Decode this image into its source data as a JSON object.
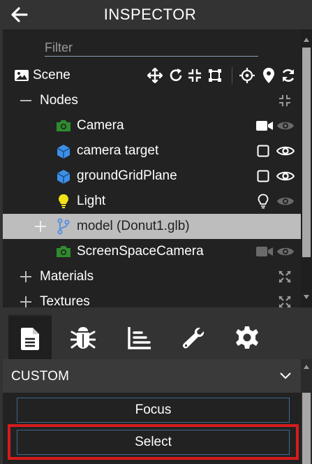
{
  "header": {
    "title": "INSPECTOR",
    "back_icon": "arrow-left-icon"
  },
  "filter": {
    "placeholder": "Filter",
    "value": ""
  },
  "scene": {
    "label": "Scene",
    "tools": [
      "move-icon",
      "rotate-icon",
      "scale-icon",
      "bounding-box-icon",
      "crosshair-icon",
      "marker-icon",
      "refresh-icon"
    ]
  },
  "nodes": {
    "label": "Nodes",
    "items": [
      {
        "label": "Camera",
        "icon": "camera-icon",
        "color": "#2e8b2e",
        "action": "video-icon",
        "visibility": "eye-icon"
      },
      {
        "label": "camera target",
        "icon": "cube-icon",
        "color": "#3d8fe6",
        "action": "checkbox-icon",
        "visibility": "eye-icon"
      },
      {
        "label": "groundGridPlane",
        "icon": "cube-icon",
        "color": "#3d8fe6",
        "action": "checkbox-icon",
        "visibility": "eye-icon"
      },
      {
        "label": "Light",
        "icon": "lightbulb-icon",
        "color": "#f2e21a",
        "action": "lightbulb-outline-icon",
        "visibility": "eye-icon"
      },
      {
        "label": "model (Donut1.glb)",
        "icon": "branch-icon",
        "color": "#5b8fe0",
        "selected": true
      },
      {
        "label": "ScreenSpaceCamera",
        "icon": "camera-icon",
        "color": "#2e8b2e",
        "action": "video-icon",
        "visibility": "eye-icon"
      }
    ]
  },
  "collapsed": [
    {
      "label": "Materials"
    },
    {
      "label": "Textures"
    }
  ],
  "tabs": [
    {
      "name": "properties-tab",
      "icon": "file-icon",
      "active": true
    },
    {
      "name": "debug-tab",
      "icon": "bug-icon"
    },
    {
      "name": "statistics-tab",
      "icon": "chart-icon"
    },
    {
      "name": "tools-tab",
      "icon": "wrench-icon"
    },
    {
      "name": "settings-tab",
      "icon": "gear-icon"
    }
  ],
  "custom": {
    "title": "CUSTOM",
    "focus_label": "Focus",
    "select_label": "Select"
  },
  "colors": {
    "highlight": "#d61c1c",
    "button_border": "#3c6b93",
    "selected_row": "#bdbdbd"
  }
}
